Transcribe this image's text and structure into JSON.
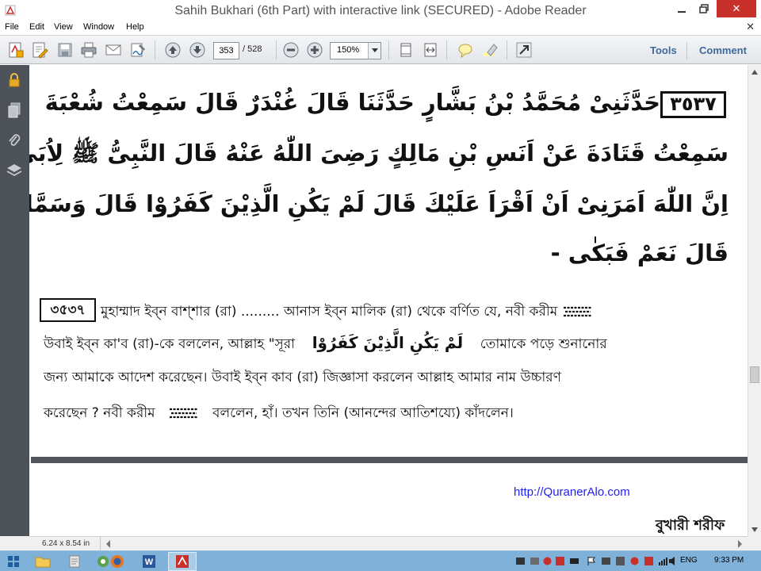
{
  "window": {
    "title": "Sahih Bukhari (6th Part) with interactive link (SECURED) - Adobe Reader",
    "close_symbol": "✕"
  },
  "menu": {
    "items": [
      "File",
      "Edit",
      "View",
      "Window",
      "Help"
    ],
    "doc_close": "✕"
  },
  "toolbar": {
    "current_page": "353",
    "total_pages": "/ 528",
    "zoom": "150%",
    "tools_label": "Tools",
    "comment_label": "Comment"
  },
  "document": {
    "arabic_hadith_number": "٣٥٣٧",
    "arabic_lines": [
      "حَدَّثَنِىْ مُحَمَّدُ بْنُ بَشَّارٍ حَدَّثَنَا قَالَ غُنْدَرٌ قَالَ سَمِعْتُ شُعْبَةَ",
      "سَمِعْتُ قَتَادَةَ عَنْ اَنَسِ بْنِ مَالِكٍ رَضِىَ اللّٰهُ عَنْهُ قَالَ النَّبِىُّ ﷺ لِاُبَىٍّ",
      "اِنَّ اللّٰهَ اَمَرَنِىْ اَنْ اَقْرَاَ عَلَيْكَ قَالَ لَمْ يَكُنِ الَّذِيْنَ كَفَرُوْا قَالَ وَسَمَّانِىْ ؟",
      "قَالَ نَعَمْ فَبَكٰى -"
    ],
    "bengali_hadith_number": "৩৫৩৭",
    "bengali_line1": "মুহাম্মাদ ইব্‌ন বাশ্‌শার (রা) ......... আনাস ইব্‌ন মালিক (রা) থেকে বর্ণিত যে, নবী করীম",
    "bengali_line2_start": "উবাই ইব্‌ন কা'ব (রা)-কে বললেন, আল্লাহ \"সূরা",
    "bengali_line2_arabic": "لَمْ يَكُنِ الَّذِيْنَ كَفَرُوْا",
    "bengali_line2_end": "তোমাকে পড়ে শুনানোর",
    "bengali_line3": "জন্য আমাকে আদেশ করেছেন। উবাই ইব্‌ন কাব (রা) জিজ্ঞাসা করলেন আল্লাহ আমার নাম উচ্চারণ",
    "bengali_line4_start": "করেছেন ? নবী করীম",
    "bengali_line4_end": "বললেন, হাঁ। তখন তিনি (আনন্দের আতিশয্যে) কাঁদলেন।",
    "footer_url": "http://QuranerAlo.com",
    "footer_book": "বুখারী শরীফ"
  },
  "status": {
    "page_size": "6.24 x 8.54 in"
  },
  "taskbar": {
    "language": "ENG",
    "time": "9:33 PM"
  },
  "colors": {
    "close_button": "#c7302b",
    "nav_panel": "#4d5158",
    "link_text": "#3e6a9a",
    "url_text": "#1f1ff0",
    "taskbar": "#7fb1d9"
  }
}
